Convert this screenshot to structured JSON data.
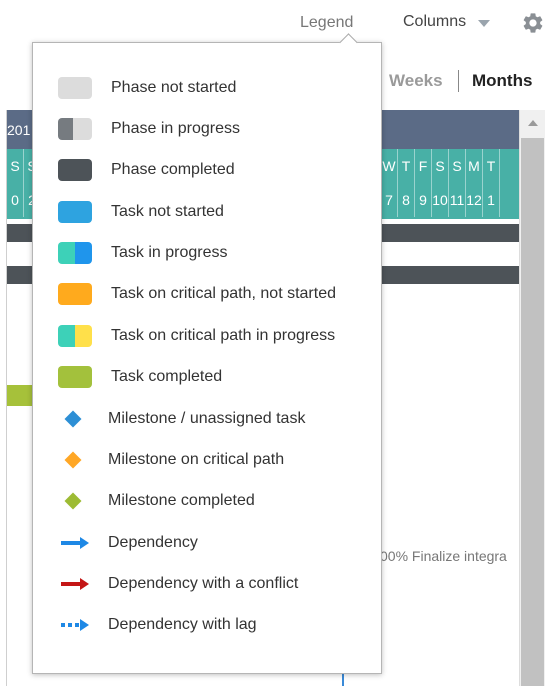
{
  "toolbar": {
    "legend_label": "Legend",
    "columns_label": "Columns"
  },
  "zoom": {
    "weeks": "Weeks",
    "months": "Months"
  },
  "gantt": {
    "year_text": "201",
    "day_letters": [
      "S",
      "S",
      "",
      "W",
      "T",
      "F",
      "S",
      "S",
      "M",
      "T"
    ],
    "day_numbers": [
      "0",
      "2",
      "",
      "7",
      "8",
      "9",
      "10",
      "11",
      "12",
      "1"
    ],
    "task_label": "00% Finalize integra"
  },
  "legend": {
    "items": [
      {
        "label": "Phase not started"
      },
      {
        "label": "Phase in progress"
      },
      {
        "label": "Phase completed"
      },
      {
        "label": "Task not started"
      },
      {
        "label": "Task in progress"
      },
      {
        "label": "Task on critical path, not started"
      },
      {
        "label": "Task on critical path in progress"
      },
      {
        "label": "Task completed"
      },
      {
        "label": "Milestone / unassigned task"
      },
      {
        "label": "Milestone on critical path"
      },
      {
        "label": "Milestone completed"
      },
      {
        "label": "Dependency"
      },
      {
        "label": "Dependency with a conflict"
      },
      {
        "label": "Dependency with lag"
      }
    ]
  },
  "colors": {
    "phase_not_started": "#dcdcdc",
    "phase_completed": "#4d5358",
    "task_not_started": "#2ea3e0",
    "task_in_progress_a": "#3dd1b8",
    "task_in_progress_b": "#1f95ec",
    "critical_not_started": "#ffaa1d",
    "critical_progress_b": "#ffe04a",
    "task_completed": "#a3c13c",
    "milestone": "#2d8fd5",
    "milestone_critical": "#ffa726",
    "milestone_completed": "#9dbb34",
    "dependency": "#1e88e5",
    "dependency_conflict": "#c41616",
    "header_year_bg": "#5b6b86",
    "header_days_bg": "#48b0a6"
  }
}
